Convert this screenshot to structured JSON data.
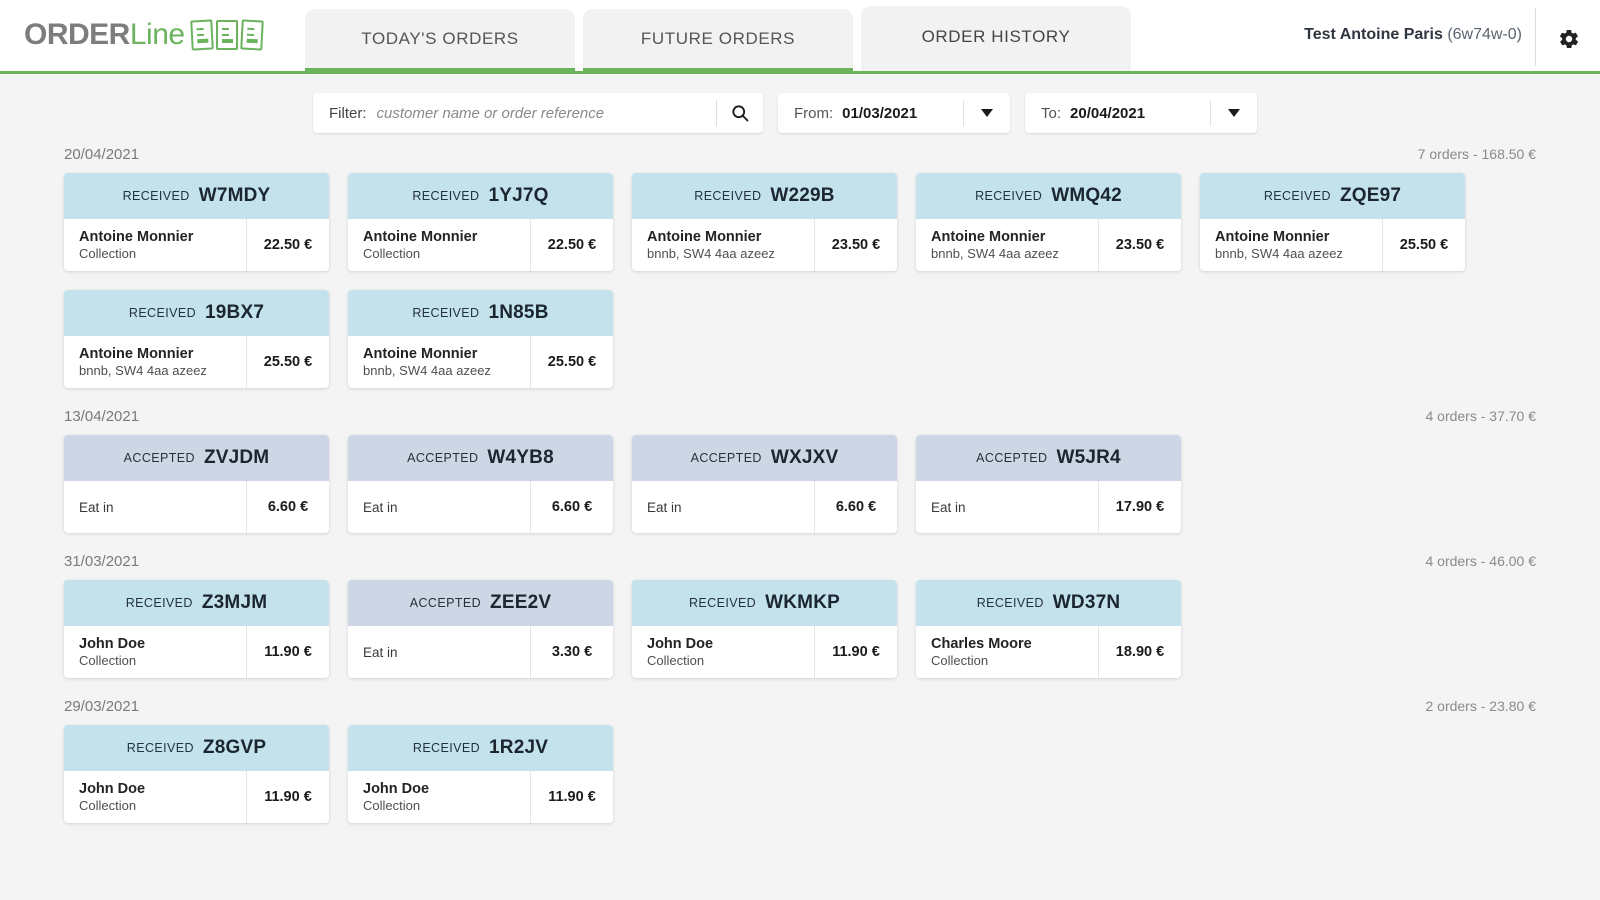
{
  "header": {
    "logo": {
      "part1": "ORDER",
      "part2": "Line",
      "icon": "documents-icon"
    },
    "tabs": [
      {
        "label": "TODAY'S ORDERS",
        "active": false
      },
      {
        "label": "FUTURE ORDERS",
        "active": false
      },
      {
        "label": "ORDER HISTORY",
        "active": true
      }
    ],
    "account": {
      "name": "Test Antoine Paris",
      "code": "(6w74w-0)"
    },
    "settings_icon": "gear-icon",
    "accent_color": "#6bb35d"
  },
  "filter": {
    "label": "Filter:",
    "placeholder": "customer name or order reference",
    "value": "",
    "search_icon": "search-icon",
    "from": {
      "label": "From:",
      "value": "01/03/2021"
    },
    "to": {
      "label": "To:",
      "value": "20/04/2021"
    }
  },
  "colors": {
    "status_received_bg": "#c3e2ec",
    "status_accepted_bg": "#ccd6e4",
    "page_bg": "#f4f4f4"
  },
  "groups": [
    {
      "date": "20/04/2021",
      "summary": "7 orders - 168.50 €",
      "orders": [
        {
          "status": "RECEIVED",
          "ref": "W7MDY",
          "customer": "Antoine Monnier",
          "detail": "Collection",
          "price": "22.50 €"
        },
        {
          "status": "RECEIVED",
          "ref": "1YJ7Q",
          "customer": "Antoine Monnier",
          "detail": "Collection",
          "price": "22.50 €"
        },
        {
          "status": "RECEIVED",
          "ref": "W229B",
          "customer": "Antoine Monnier",
          "detail": "bnnb, SW4 4aa azeez",
          "price": "23.50 €"
        },
        {
          "status": "RECEIVED",
          "ref": "WMQ42",
          "customer": "Antoine Monnier",
          "detail": "bnnb, SW4 4aa azeez",
          "price": "23.50 €"
        },
        {
          "status": "RECEIVED",
          "ref": "ZQE97",
          "customer": "Antoine Monnier",
          "detail": "bnnb, SW4 4aa azeez",
          "price": "25.50 €"
        },
        {
          "status": "RECEIVED",
          "ref": "19BX7",
          "customer": "Antoine Monnier",
          "detail": "bnnb, SW4 4aa azeez",
          "price": "25.50 €"
        },
        {
          "status": "RECEIVED",
          "ref": "1N85B",
          "customer": "Antoine Monnier",
          "detail": "bnnb, SW4 4aa azeez",
          "price": "25.50 €"
        }
      ]
    },
    {
      "date": "13/04/2021",
      "summary": "4 orders - 37.70 €",
      "orders": [
        {
          "status": "ACCEPTED",
          "ref": "ZVJDM",
          "customer": "",
          "detail": "Eat in",
          "price": "6.60 €"
        },
        {
          "status": "ACCEPTED",
          "ref": "W4YB8",
          "customer": "",
          "detail": "Eat in",
          "price": "6.60 €"
        },
        {
          "status": "ACCEPTED",
          "ref": "WXJXV",
          "customer": "",
          "detail": "Eat in",
          "price": "6.60 €"
        },
        {
          "status": "ACCEPTED",
          "ref": "W5JR4",
          "customer": "",
          "detail": "Eat in",
          "price": "17.90 €"
        }
      ]
    },
    {
      "date": "31/03/2021",
      "summary": "4 orders - 46.00 €",
      "orders": [
        {
          "status": "RECEIVED",
          "ref": "Z3MJM",
          "customer": "John Doe",
          "detail": "Collection",
          "price": "11.90 €"
        },
        {
          "status": "ACCEPTED",
          "ref": "ZEE2V",
          "customer": "",
          "detail": "Eat in",
          "price": "3.30 €"
        },
        {
          "status": "RECEIVED",
          "ref": "WKMKP",
          "customer": "John Doe",
          "detail": "Collection",
          "price": "11.90 €"
        },
        {
          "status": "RECEIVED",
          "ref": "WD37N",
          "customer": "Charles Moore",
          "detail": "Collection",
          "price": "18.90 €"
        }
      ]
    },
    {
      "date": "29/03/2021",
      "summary": "2 orders - 23.80 €",
      "orders": [
        {
          "status": "RECEIVED",
          "ref": "Z8GVP",
          "customer": "John Doe",
          "detail": "Collection",
          "price": "11.90 €"
        },
        {
          "status": "RECEIVED",
          "ref": "1R2JV",
          "customer": "John Doe",
          "detail": "Collection",
          "price": "11.90 €"
        }
      ]
    }
  ]
}
